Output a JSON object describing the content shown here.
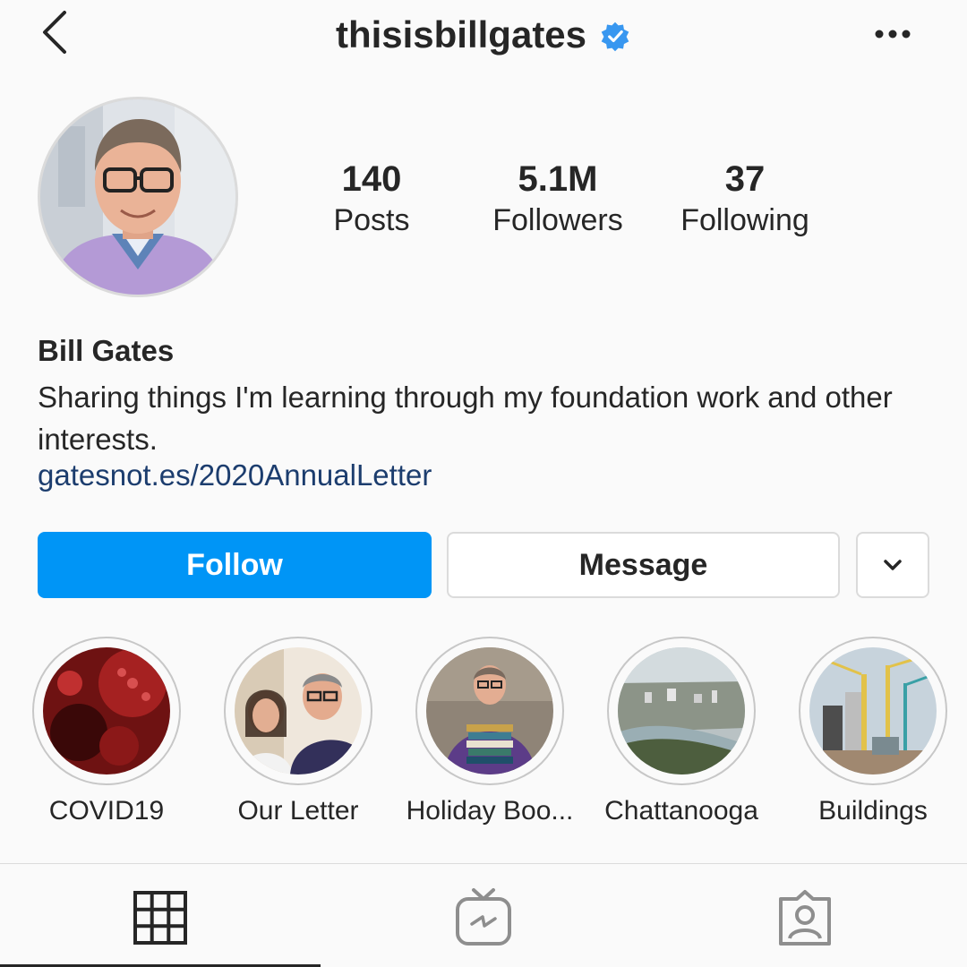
{
  "header": {
    "back_icon": "chevron-left-icon",
    "username": "thisisbillgates",
    "verified_icon": "verified-badge-icon",
    "more_icon": "more-horizontal-icon"
  },
  "profile": {
    "avatar": "profile-photo",
    "stats": [
      {
        "value": "140",
        "label": "Posts"
      },
      {
        "value": "5.1M",
        "label": "Followers"
      },
      {
        "value": "37",
        "label": "Following"
      }
    ],
    "full_name": "Bill Gates",
    "bio": "Sharing things I'm learning through my foundation work and other interests.",
    "link": "gatesnot.es/2020AnnualLetter"
  },
  "actions": {
    "follow_label": "Follow",
    "message_label": "Message",
    "suggest_icon": "chevron-down-icon"
  },
  "highlights": [
    {
      "label": "COVID19"
    },
    {
      "label": "Our Letter"
    },
    {
      "label": "Holiday Boo..."
    },
    {
      "label": "Chattanooga"
    },
    {
      "label": "Buildings"
    }
  ],
  "tabs": [
    {
      "icon": "grid-icon",
      "active": true
    },
    {
      "icon": "igtv-icon",
      "active": false
    },
    {
      "icon": "tagged-icon",
      "active": false
    }
  ],
  "colors": {
    "accent": "#0095f6",
    "link": "#1c3d6e",
    "verified": "#3897f0",
    "background": "#fafafa"
  }
}
